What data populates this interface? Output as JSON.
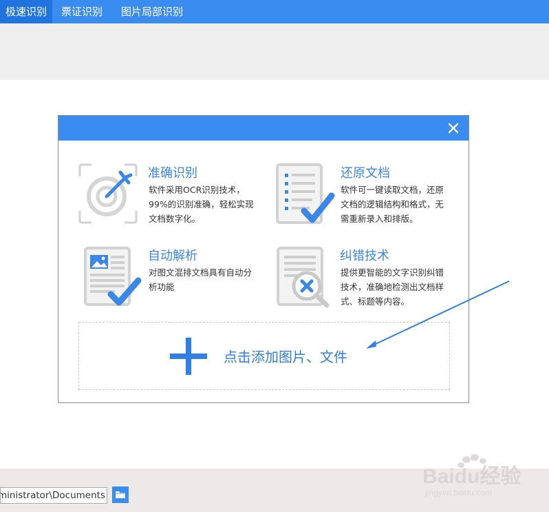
{
  "tabs": [
    {
      "label": "极速识别",
      "active": true
    },
    {
      "label": "票证识别",
      "active": false
    },
    {
      "label": "图片局部识别",
      "active": false
    }
  ],
  "features": [
    {
      "title": "准确识别",
      "desc": "软件采用OCR识别技术，99%的识别准确，轻松实现文档数字化。",
      "icon": "target-icon"
    },
    {
      "title": "还原文档",
      "desc": "软件可一键读取文档，还原文档的逻辑结构和格式，无需重新录入和排版。",
      "icon": "document-check-icon"
    },
    {
      "title": "自动解析",
      "desc": "对图文混排文档具有自动分析功能",
      "icon": "image-document-check-icon"
    },
    {
      "title": "纠错技术",
      "desc": "提供更智能的文字识别纠错技术，准确地检测出文档样式、标题等内容。",
      "icon": "document-magnifier-error-icon"
    }
  ],
  "dropzone": {
    "label": "点击添加图片、文件"
  },
  "output_path": {
    "value": "C:\\Users\\Administrator\\Documents"
  },
  "watermark": {
    "text": "Baidu经验",
    "sub": "jingyan.baidu.com"
  },
  "colors": {
    "accent": "#3b8cf1",
    "accent_dark": "#2173e0",
    "title_text": "#3b87e8"
  }
}
